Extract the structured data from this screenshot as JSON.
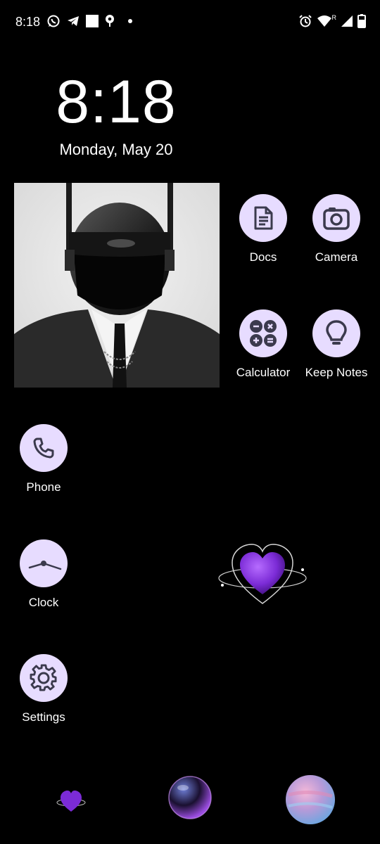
{
  "status_bar": {
    "time": "8:18",
    "left_icons": [
      "whatsapp-icon",
      "telegram-icon",
      "square-icon",
      "location-icon",
      "dot-icon"
    ],
    "right_icons": [
      "alarm-icon",
      "wifi-icon",
      "signal-icon",
      "battery-icon"
    ],
    "roaming_label": "R"
  },
  "clock_widget": {
    "time": "8:18",
    "date": "Monday, May 20"
  },
  "apps": {
    "docs": {
      "label": "Docs",
      "icon": "docs-icon"
    },
    "camera": {
      "label": "Camera",
      "icon": "camera-icon"
    },
    "calculator": {
      "label": "Calculator",
      "icon": "calculator-icon"
    },
    "keep_notes": {
      "label": "Keep Notes",
      "icon": "lightbulb-icon"
    },
    "phone": {
      "label": "Phone",
      "icon": "phone-icon"
    },
    "clock": {
      "label": "Clock",
      "icon": "clock-icon"
    },
    "settings": {
      "label": "Settings",
      "icon": "gear-icon"
    }
  },
  "colors": {
    "icon_background": "#e7dcff",
    "icon_glyph": "#3b3a4d",
    "accent_purple": "#7b2bd6"
  }
}
